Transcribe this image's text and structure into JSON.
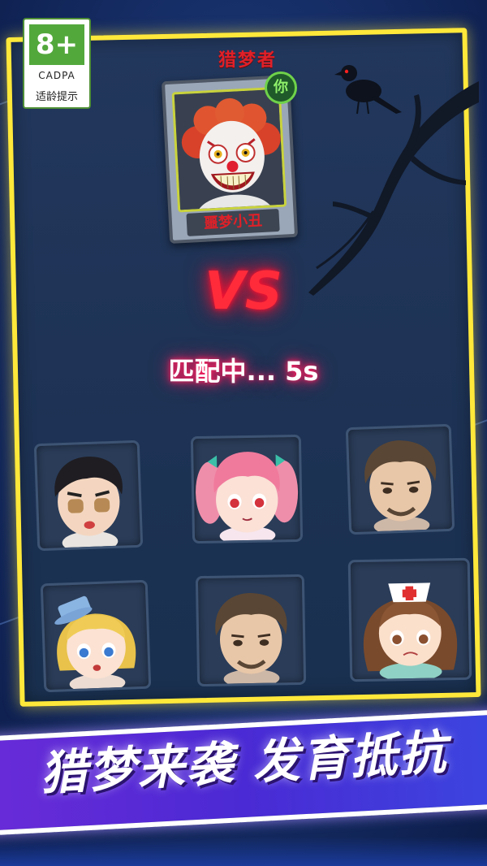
{
  "rating": {
    "age": "8+",
    "org": "CADPA",
    "tip": "适龄提示"
  },
  "hunter": {
    "title": "猎梦者",
    "badge": "你",
    "name": "噩梦小丑"
  },
  "match": {
    "vs": "VS",
    "status": "匹配中... 5s"
  },
  "survivors": [
    {
      "name": "survivor-boy-black-hair"
    },
    {
      "name": "survivor-girl-pink-twintails"
    },
    {
      "name": "survivor-man-beard-1"
    },
    {
      "name": "survivor-girl-blonde-top-hat"
    },
    {
      "name": "survivor-man-beard-2"
    },
    {
      "name": "survivor-nurse"
    }
  ],
  "banner": {
    "text": "猎梦来袭 发育抵抗"
  },
  "colors": {
    "frame": "#ffe83a",
    "vs": "#ff2b3a",
    "hunter_name": "#e02028",
    "banner": "#5a2ad8"
  }
}
